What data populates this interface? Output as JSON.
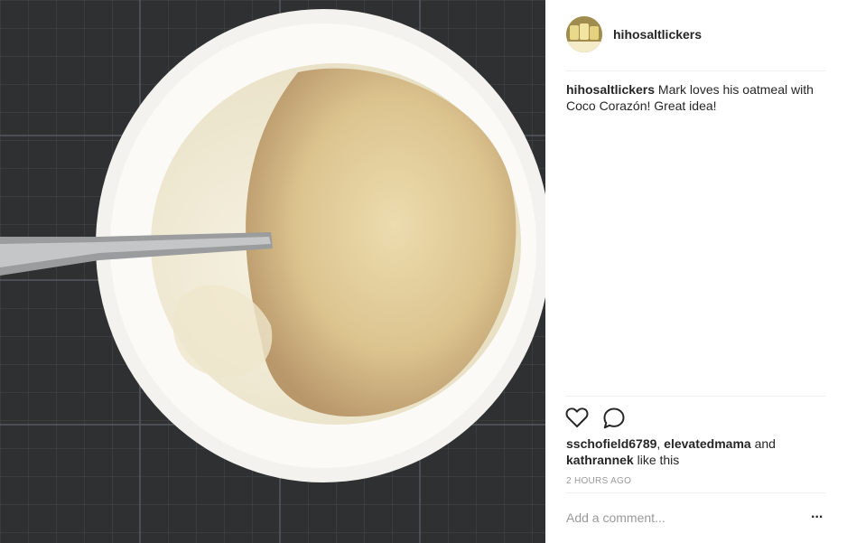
{
  "post": {
    "username": "hihosaltlickers",
    "caption_user": "hihosaltlickers",
    "caption_text": " Mark loves his oatmeal with Coco Corazón! Great idea!",
    "likes": {
      "user1": "sschofield6789",
      "sep1": ", ",
      "user2": "elevatedmama",
      "sep2": " and",
      "user3": "kathrannek",
      "suffix": " like this"
    },
    "time": "2 HOURS AGO",
    "comment_placeholder": "Add a comment...",
    "more_label": "..."
  },
  "icons": {
    "like": "heart-icon",
    "comment": "comment-icon",
    "more": "more-options-icon"
  },
  "colors": {
    "text": "#262626",
    "muted": "#999999",
    "divider": "#efefef"
  }
}
